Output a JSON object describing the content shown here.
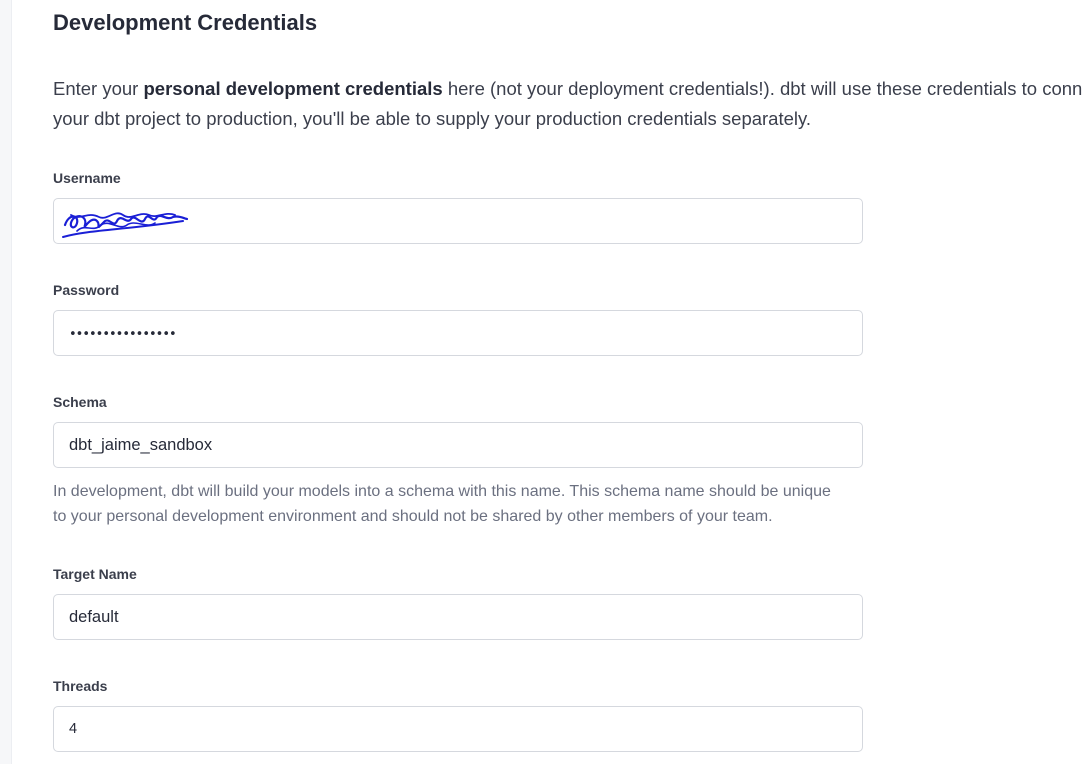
{
  "page": {
    "title": "Development Credentials",
    "intro_prefix": "Enter your ",
    "intro_bold": "personal development credentials",
    "intro_suffix_line1": " here (not your deployment credentials!). dbt will use these credentials to conn",
    "intro_line2": "your dbt project to production, you'll be able to supply your production credentials separately."
  },
  "fields": {
    "username": {
      "label": "Username",
      "value": ""
    },
    "password": {
      "label": "Password",
      "value": "••••••••••••••••"
    },
    "schema": {
      "label": "Schema",
      "value": "dbt_jaime_sandbox",
      "help_line1": "In development, dbt will build your models into a schema with this name. This schema name should be unique",
      "help_line2": "to your personal development environment and should not be shared by other members of your team."
    },
    "target_name": {
      "label": "Target Name",
      "value": "default"
    },
    "threads": {
      "label": "Threads",
      "value": "4"
    }
  },
  "colors": {
    "input_border": "#d5d8de",
    "text_primary": "#262a38",
    "text_help": "#6b7080",
    "redaction_scribble": "#1a1fd6"
  }
}
